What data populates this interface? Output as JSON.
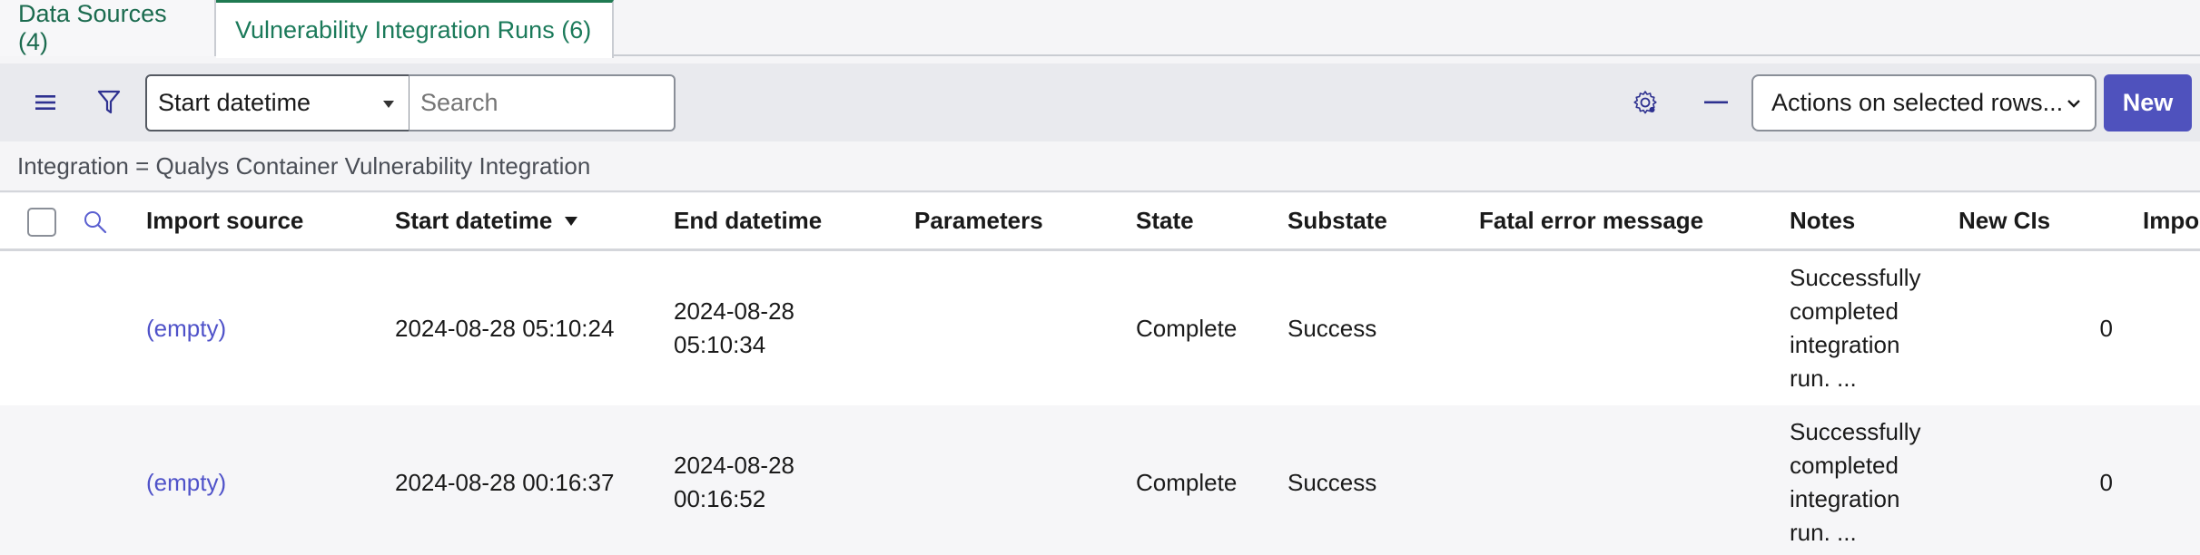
{
  "tabs": [
    {
      "label": "Data Sources (4)",
      "active": false
    },
    {
      "label": "Vulnerability Integration Runs (6)",
      "active": true
    }
  ],
  "toolbar": {
    "menu_icon": "hamburger-menu-icon",
    "filter_icon": "funnel-filter-icon",
    "search_field_select": "Start datetime",
    "search_placeholder": "Search",
    "settings_icon": "gear-icon",
    "collapse_icon": "minus-icon",
    "actions_select": "Actions on selected rows...",
    "new_label": "New"
  },
  "breadcrumb": {
    "filter_text": "Integration = Qualys Container Vulnerability Integration"
  },
  "table": {
    "columns": [
      {
        "label": "Import source"
      },
      {
        "label": "Start datetime",
        "sorted": "descending"
      },
      {
        "label": "End datetime"
      },
      {
        "label": "Parameters"
      },
      {
        "label": "State"
      },
      {
        "label": "Substate"
      },
      {
        "label": "Fatal error message"
      },
      {
        "label": "Notes"
      },
      {
        "label": "New CIs"
      },
      {
        "label": "Impo"
      }
    ],
    "rows": [
      {
        "import_source": "(empty)",
        "start_datetime": "2024-08-28 05:10:24",
        "end_date": "2024-08-28",
        "end_time": "05:10:34",
        "parameters": "",
        "state": "Complete",
        "substate": "Success",
        "fatal_error": "",
        "notes": [
          "Successfully",
          "completed",
          "integration",
          "run. ..."
        ],
        "new_cis": "0"
      },
      {
        "import_source": "(empty)",
        "start_datetime": "2024-08-28 00:16:37",
        "end_date": "2024-08-28",
        "end_time": "00:16:52",
        "parameters": "",
        "state": "Complete",
        "substate": "Success",
        "fatal_error": "",
        "notes": [
          "Successfully",
          "completed",
          "integration",
          "run. ..."
        ],
        "new_cis": "0"
      }
    ]
  },
  "colors": {
    "tab_text": "#1b6b4f",
    "tab_active_border": "#1f7a52",
    "primary_button": "#4f52bd",
    "link": "#4f52c9",
    "toolbar_bg": "#e9eaee"
  }
}
